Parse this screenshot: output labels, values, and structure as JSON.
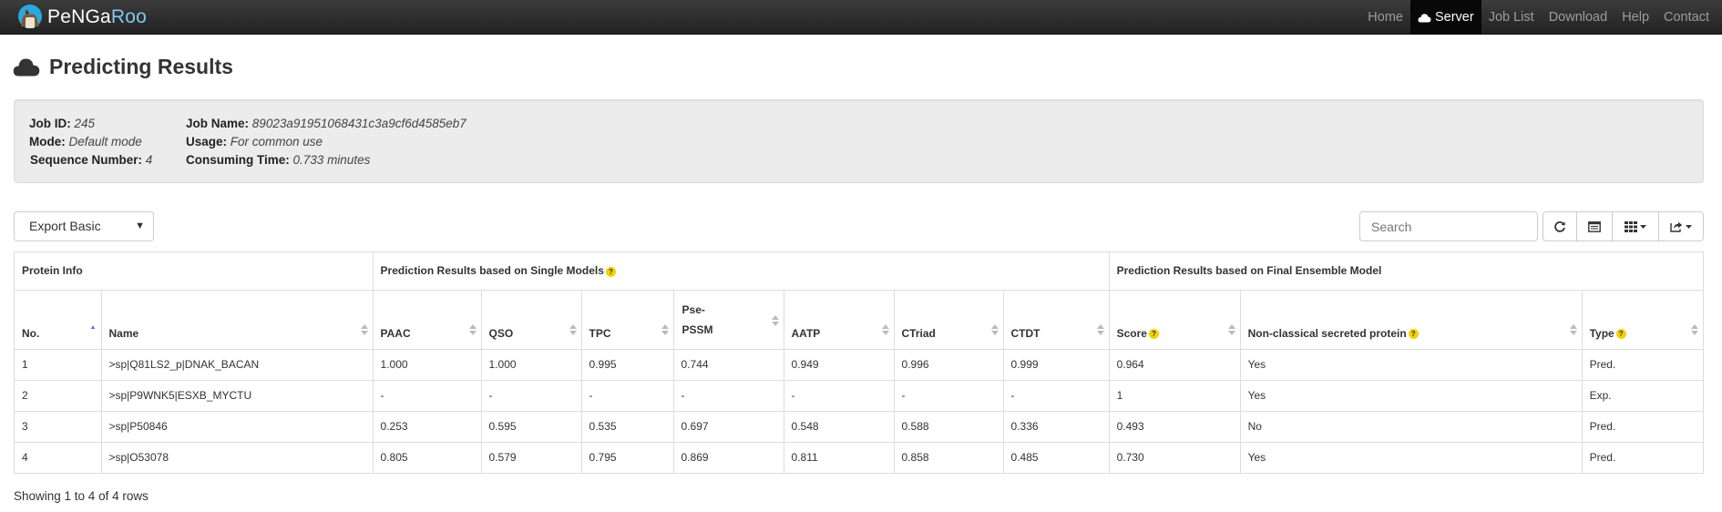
{
  "nav": {
    "brand_part1": "PeNGa",
    "brand_part2": "Roo",
    "items": [
      {
        "label": "Home",
        "active": false
      },
      {
        "label": "Server",
        "active": true
      },
      {
        "label": "Job List",
        "active": false
      },
      {
        "label": "Download",
        "active": false
      },
      {
        "label": "Help",
        "active": false
      },
      {
        "label": "Contact",
        "active": false
      }
    ]
  },
  "page": {
    "title": "Predicting Results"
  },
  "job": {
    "id_label": "Job ID:",
    "id_value": "245",
    "mode_label": "Mode:",
    "mode_value": "Default mode",
    "seq_label": "Sequence Number:",
    "seq_value": "4",
    "name_label": "Job Name:",
    "name_value": "89023a91951068431c3a9cf6d4585eb7",
    "usage_label": "Usage:",
    "usage_value": "For common use",
    "time_label": "Consuming Time:",
    "time_value": "0.733 minutes"
  },
  "toolbar": {
    "export_label": "Export Basic",
    "search_placeholder": "Search"
  },
  "table": {
    "groups": [
      "Protein Info",
      "Prediction Results based on Single Models",
      "Prediction Results based on Final Ensemble Model"
    ],
    "columns": [
      "No.",
      "Name",
      "PAAC",
      "QSO",
      "TPC",
      "Pse-",
      "PSSM",
      "AATP",
      "CTriad",
      "CTDT",
      "Score",
      "Non-classical secreted protein",
      "Type"
    ],
    "rows": [
      [
        "1",
        ">sp|Q81LS2_p|DNAK_BACAN",
        "1.000",
        "1.000",
        "0.995",
        "0.744",
        "0.949",
        "0.996",
        "0.999",
        "0.964",
        "Yes",
        "Pred."
      ],
      [
        "2",
        ">sp|P9WNK5|ESXB_MYCTU",
        "-",
        "-",
        "-",
        "-",
        "-",
        "-",
        "-",
        "1",
        "Yes",
        "Exp."
      ],
      [
        "3",
        ">sp|P50846",
        "0.253",
        "0.595",
        "0.535",
        "0.697",
        "0.548",
        "0.588",
        "0.336",
        "0.493",
        "No",
        "Pred."
      ],
      [
        "4",
        ">sp|O53078",
        "0.805",
        "0.579",
        "0.795",
        "0.869",
        "0.811",
        "0.858",
        "0.485",
        "0.730",
        "Yes",
        "Pred."
      ]
    ]
  },
  "footer": {
    "showing": "Showing 1 to 4 of 4 rows"
  },
  "colors": {
    "navbar": "#222222",
    "help_badge": "#f2d200",
    "sort_active": "#6f6fd8"
  },
  "icons": [
    "cloud-icon",
    "refresh-icon",
    "toggle-view-icon",
    "columns-icon",
    "export-icon",
    "help-icon"
  ]
}
